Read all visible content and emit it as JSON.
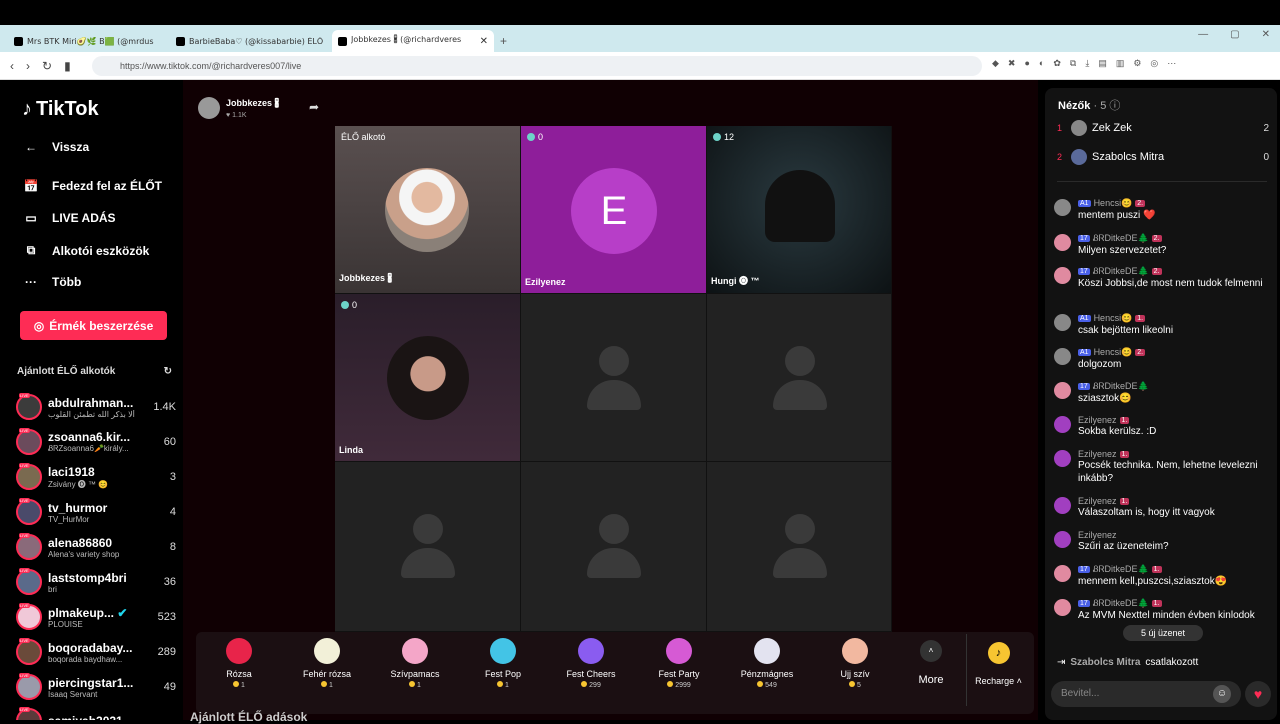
{
  "browser": {
    "tabs": [
      {
        "title": "Mrs BTK Miri🥑🌿 B🟩 (@mrdus"
      },
      {
        "title": "BarbieBaba♡ (@kissabarbie) ÉLŐ ad"
      },
      {
        "title": "Jobbkezes 🖁 (@richardveres"
      }
    ],
    "url": "https://www.tiktok.com/@richardveres007/live"
  },
  "sidebar": {
    "logo": "TikTok",
    "nav": [
      {
        "icon": "←",
        "label": "Vissza"
      },
      {
        "icon": "📅",
        "label": "Fedezd fel az ÉLŐT"
      },
      {
        "icon": "▭",
        "label": "LIVE ADÁS"
      },
      {
        "icon": "⧉",
        "label": "Alkotói eszközök"
      },
      {
        "icon": "···",
        "label": "Több"
      }
    ],
    "coins_button": "Érmék beszerzése",
    "recommended_title": "Ajánlott ÉLŐ alkotók",
    "creators": [
      {
        "name": "abdulrahman...",
        "sub": "ألا بذكر الله تطمئن القلوب",
        "viewers": "1.4K"
      },
      {
        "name": "zsoanna6.kir...",
        "sub": "ᏰᏒZsoanna6🥕király...",
        "viewers": "60"
      },
      {
        "name": "laci1918",
        "sub": "Zsivány 🅞 ™ 😊",
        "viewers": "3"
      },
      {
        "name": "tv_hurmor",
        "sub": "TV_HurMor",
        "viewers": "4"
      },
      {
        "name": "alena86860",
        "sub": "Alena's variety shop",
        "viewers": "8"
      },
      {
        "name": "laststomp4bri",
        "sub": "bri",
        "viewers": "36"
      },
      {
        "name": "plmakeup...",
        "sub": "PLOUISE",
        "viewers": "523"
      },
      {
        "name": "boqoradabay...",
        "sub": "boqorada baydhaw...",
        "viewers": "289"
      },
      {
        "name": "piercingstar1...",
        "sub": "Isaaq Servant",
        "viewers": "49"
      },
      {
        "name": "samiyah2021",
        "sub": "",
        "viewers": ""
      }
    ]
  },
  "stream": {
    "host_name": "Jobbkezes 🖁",
    "host_likes": "♥ 1.1K",
    "cells": [
      {
        "tag": "ÉLŐ alkotó",
        "label": "Jobbkezes 🖁",
        "count": ""
      },
      {
        "tag": "",
        "label": "Ezilyenez",
        "count": "0",
        "letter": "E"
      },
      {
        "tag": "",
        "label": "Hungi 🅞 ™",
        "count": "12"
      },
      {
        "tag": "",
        "label": "Linda",
        "count": "0"
      }
    ],
    "gifts": [
      {
        "name": "Rózsa",
        "price": "1",
        "color": "#e8244a"
      },
      {
        "name": "Fehér rózsa",
        "price": "1",
        "color": "#f2f0d8"
      },
      {
        "name": "Szívpamacs",
        "price": "1",
        "color": "#f4a6c8"
      },
      {
        "name": "Fest Pop",
        "price": "1",
        "color": "#43c4e6"
      },
      {
        "name": "Fest Cheers",
        "price": "299",
        "color": "#8a5cf0"
      },
      {
        "name": "Fest Party",
        "price": "2999",
        "color": "#d65ad4"
      },
      {
        "name": "Pénzmágnes",
        "price": "549",
        "color": "#e3e3f0"
      },
      {
        "name": "Ujj szív",
        "price": "5",
        "color": "#f2b8a0"
      }
    ],
    "more_label": "More",
    "recharge_label": "Recharge ˄",
    "footer_title": "Ajánlott ÉLŐ adások"
  },
  "chat": {
    "title": "Nézők",
    "count": "· 5",
    "viewers": [
      {
        "rank": "1",
        "name": "Zek Zek",
        "score": "2"
      },
      {
        "rank": "2",
        "name": "Szabolcs Mitra",
        "score": "0"
      }
    ],
    "messages": [
      {
        "user": "Hencsi😊",
        "b1": "A1",
        "b2": "2.",
        "text": "mentem puszi ❤️",
        "color": "#888"
      },
      {
        "user": "ᏰᏒDitkeDE🌲",
        "b1": "17",
        "b2": "2.",
        "text": "Milyen szervezetet?",
        "color": "#e08aa0"
      },
      {
        "user": "ᏰᏒDitkeDE🌲",
        "b1": "17",
        "b2": "2.",
        "text": "Köszi Jobbsi,de most nem tudok felmenni",
        "color": "#e08aa0"
      },
      {
        "user": "Hencsi😊",
        "b1": "A1",
        "b2": "1.",
        "text": "csak bejöttem likeolni",
        "color": "#888"
      },
      {
        "user": "Hencsi😊",
        "b1": "A1",
        "b2": "2.",
        "text": "dolgozom",
        "color": "#888"
      },
      {
        "user": "ᏰᏒDitkeDE🌲",
        "b1": "17",
        "b2": "",
        "text": "sziasztok😊",
        "color": "#e08aa0"
      },
      {
        "user": "Ezilyenez",
        "b1": "",
        "b2": "1.",
        "text": "Sokba kerülsz. :D",
        "color": "#a13fc0"
      },
      {
        "user": "Ezilyenez",
        "b1": "",
        "b2": "1.",
        "text": "Pocsék technika. Nem, lehetne levelezni inkább?",
        "color": "#a13fc0"
      },
      {
        "user": "Ezilyenez",
        "b1": "",
        "b2": "1.",
        "text": "Válaszoltam is, hogy itt vagyok",
        "color": "#a13fc0"
      },
      {
        "user": "Ezilyenez",
        "b1": "",
        "b2": "",
        "text": "Szűri az üzeneteim?",
        "color": "#a13fc0"
      },
      {
        "user": "ᏰᏒDitkeDE🌲",
        "b1": "17",
        "b2": "1.",
        "text": "mennem kell,puszcsi,sziasztok😍",
        "color": "#e08aa0"
      },
      {
        "user": "ᏰᏒDitkeDE🌲",
        "b1": "17",
        "b2": "1.",
        "text": "Az MVM Nexttel minden évben kinlodok",
        "color": "#e08aa0"
      }
    ],
    "new_messages": "5 új üzenet",
    "joined_user": "Szabolcs Mitra",
    "joined_text": "csatlakozott",
    "input_placeholder": "Bevitel..."
  }
}
